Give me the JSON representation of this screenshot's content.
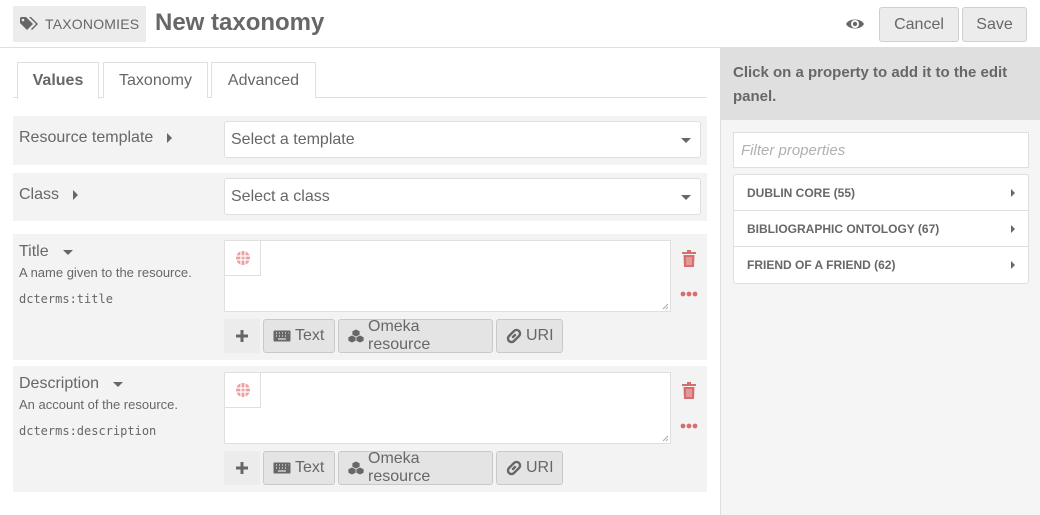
{
  "header": {
    "breadcrumb_label": "TAXONOMIES",
    "breadcrumb_icon": "tags-icon",
    "title": "New taxonomy",
    "preview_icon": "eye-icon",
    "cancel_label": "Cancel",
    "save_label": "Save"
  },
  "tabs": [
    {
      "label": "Values",
      "active": true
    },
    {
      "label": "Taxonomy",
      "active": false
    },
    {
      "label": "Advanced",
      "active": false
    }
  ],
  "form": {
    "resource_template": {
      "label": "Resource template",
      "placeholder": "Select a template"
    },
    "resource_class": {
      "label": "Class",
      "placeholder": "Select a class"
    },
    "properties": [
      {
        "label": "Title",
        "description": "A name given to the resource.",
        "term": "dcterms:title",
        "value": ""
      },
      {
        "label": "Description",
        "description": "An account of the resource.",
        "term": "dcterms:description",
        "value": ""
      }
    ],
    "value_buttons": {
      "text": "Text",
      "resource": "Omeka resource",
      "uri": "URI"
    }
  },
  "sidebar": {
    "instructions": "Click on a property to add it to the edit panel.",
    "filter_placeholder": "Filter properties",
    "vocabularies": [
      {
        "label": "DUBLIN CORE (55)"
      },
      {
        "label": "BIBLIOGRAPHIC ONTOLOGY (67)"
      },
      {
        "label": "FRIEND OF A FRIEND (62)"
      }
    ]
  },
  "colors": {
    "text": "#676767",
    "danger": "#e07a7a",
    "panel": "#f3f3f3",
    "sidebar_head": "#dfdfdf"
  }
}
